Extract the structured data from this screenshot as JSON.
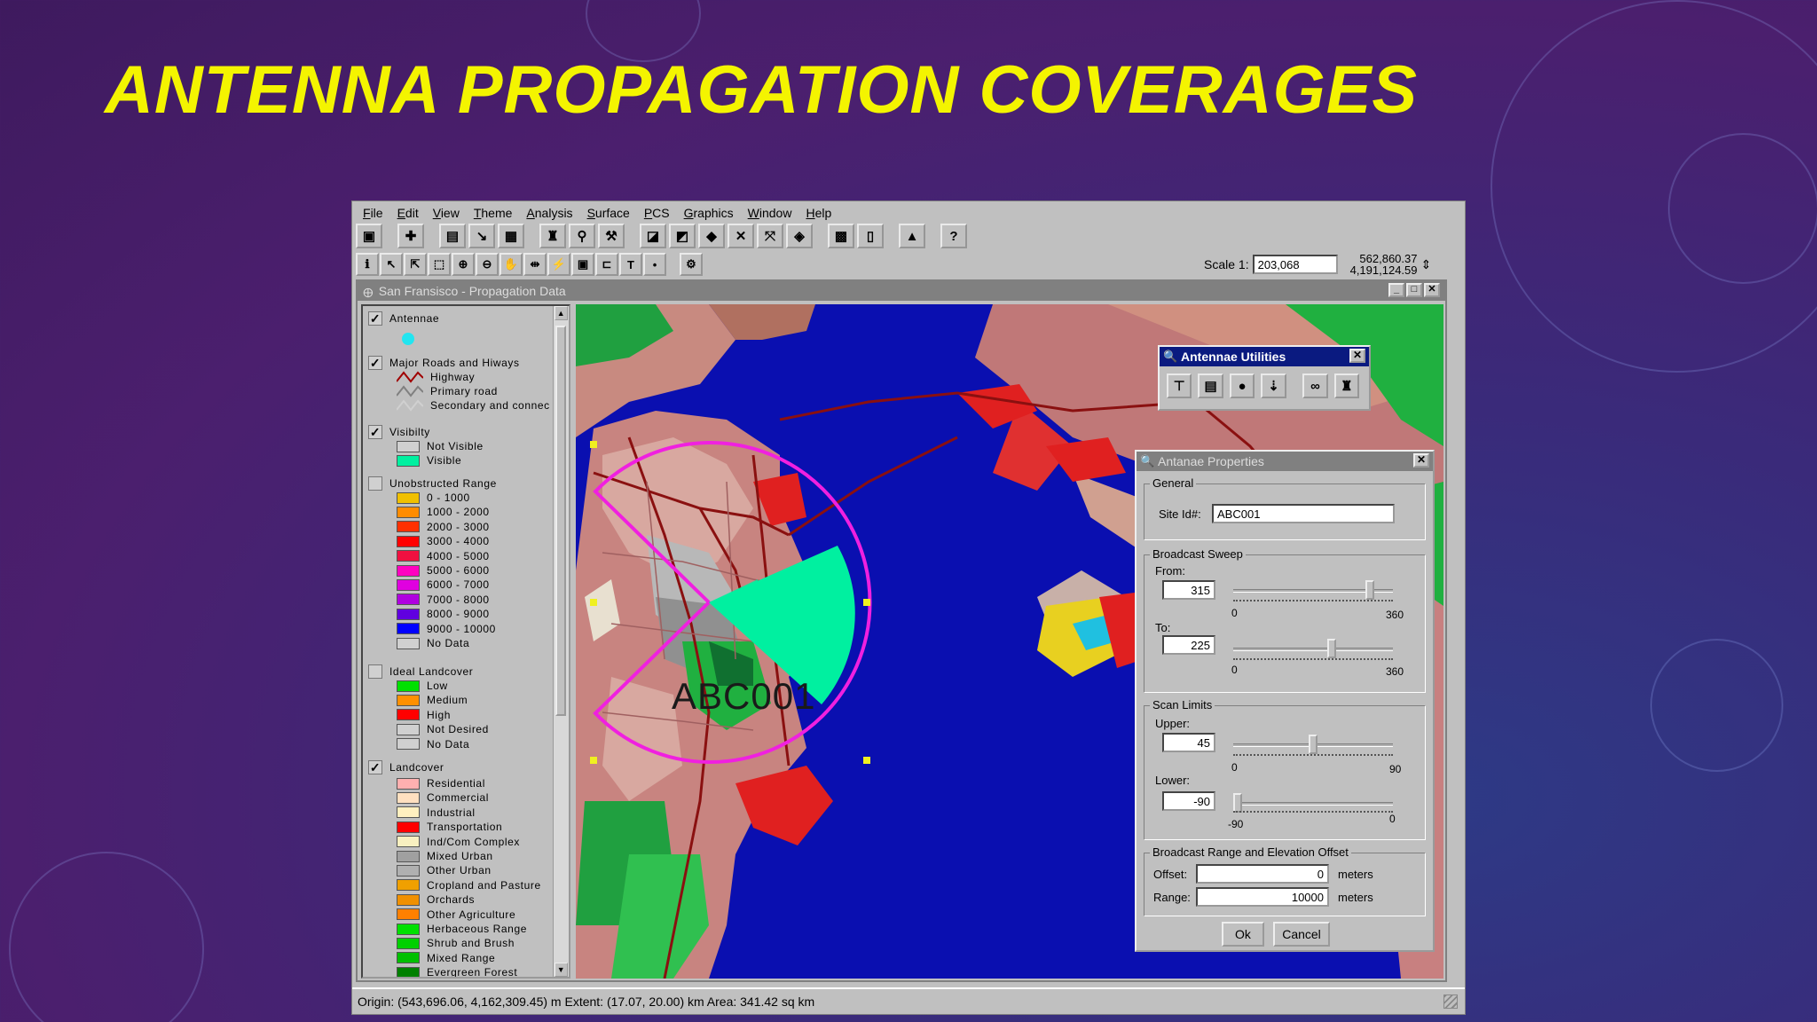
{
  "slide": {
    "title": "ANTENNA PROPAGATION COVERAGES"
  },
  "menu": [
    "File",
    "Edit",
    "View",
    "Theme",
    "Analysis",
    "Surface",
    "PCS",
    "Graphics",
    "Window",
    "Help"
  ],
  "toolbar": {
    "row1_icons": [
      "save-icon",
      "add-theme-icon",
      "properties-icon",
      "edit-legend-icon",
      "table-icon",
      "find-icon",
      "locate-icon",
      "hotlink-icon",
      "zoom-theme-icon",
      "zoom-selected-icon",
      "zoom-active-icon",
      "zoom-full-icon",
      "zoom-previous-icon",
      "select-all-icon",
      "clear-select-icon",
      "layout-icon",
      "help-icon"
    ],
    "row2_icons": [
      "identify-icon",
      "pointer-icon",
      "vertex-edit-icon",
      "select-feature-icon",
      "zoom-in-icon",
      "zoom-out-icon",
      "pan-icon",
      "measure-icon",
      "hotlink-tool-icon",
      "area-select-icon",
      "label-icon",
      "text-icon",
      "draw-point-icon",
      "antenna-tool-icon"
    ],
    "scale_label": "Scale 1:",
    "scale_value": "203,068",
    "coord_x": "562,860.37",
    "coord_y": "4,191,124.59"
  },
  "view": {
    "title": "San Fransisco - Propagation Data"
  },
  "legend": {
    "antennae": "Antennae",
    "roads": {
      "title": "Major Roads and Hiways",
      "items": [
        "Highway",
        "Primary road",
        "Secondary and connec"
      ]
    },
    "visibility": {
      "title": "Visibilty",
      "items": [
        "Not Visible",
        "Visible"
      ]
    },
    "range": {
      "title": "Unobstructed Range",
      "items": [
        "0 - 1000",
        "1000 - 2000",
        "2000 - 3000",
        "3000 - 4000",
        "4000 - 5000",
        "5000 - 6000",
        "6000 - 7000",
        "7000 - 8000",
        "8000 - 9000",
        "9000 - 10000",
        "No Data"
      ]
    },
    "ideal": {
      "title": "Ideal Landcover",
      "items": [
        "Low",
        "Medium",
        "High",
        "Not Desired",
        "No Data"
      ]
    },
    "landcover": {
      "title": "Landcover",
      "items": [
        "Residential",
        "Commercial",
        "Industrial",
        "Transportation",
        "Ind/Com Complex",
        "Mixed Urban",
        "Other Urban",
        "Cropland and Pasture",
        "Orchards",
        "Other Agriculture",
        "Herbaceous Range",
        "Shrub and Brush",
        "Mixed Range",
        "Evergreen Forest"
      ]
    },
    "colors": {
      "range": [
        "#f0c000",
        "#ff8c00",
        "#ff3000",
        "#ff0000",
        "#f01040",
        "#ff00c0",
        "#e000e0",
        "#b000e0",
        "#6000e0",
        "#0000ff",
        "#d0d0d0"
      ],
      "ideal": [
        "#00e000",
        "#ff9000",
        "#ff0000",
        "#d0d0d0",
        "#d0d0d0"
      ],
      "landcover": [
        "#ffb0b0",
        "#ffe0c0",
        "#fff0c0",
        "#ff0000",
        "#f8f0c0",
        "#a0a0a0",
        "#b0b0b0",
        "#f0a000",
        "#f09000",
        "#ff8000",
        "#00e000",
        "#00d000",
        "#00c000",
        "#008000"
      ],
      "visibility": [
        "#d0d0d0",
        "#00f0a0"
      ]
    }
  },
  "map": {
    "site_label": "ABC001"
  },
  "utilities": {
    "title": "Antennae Utilities",
    "icons": [
      "antenna-add-icon",
      "antenna-table-icon",
      "coverage-icon",
      "antenna-move-icon",
      "antenna-view-icon",
      "antenna-find-icon"
    ]
  },
  "properties": {
    "title": "Antanae Properties",
    "general_label": "General",
    "site_id_label": "Site Id#:",
    "site_id": "ABC001",
    "sweep_label": "Broadcast Sweep",
    "from_label": "From:",
    "from_value": "315",
    "from_min": "0",
    "from_max": "360",
    "from_level": 0.875,
    "to_label": "To:",
    "to_value": "225",
    "to_min": "0",
    "to_max": "360",
    "to_level": 0.625,
    "scan_label": "Scan Limits",
    "upper_label": "Upper:",
    "upper_value": "45",
    "upper_min": "0",
    "upper_max": "90",
    "upper_level": 0.5,
    "lower_label": "Lower:",
    "lower_value": "-90",
    "lower_min": "-90",
    "lower_max": "0",
    "lower_level": 0.0,
    "range_group_label": "Broadcast Range and Elevation Offset",
    "offset_label": "Offset:",
    "offset_value": "0",
    "offset_unit": "meters",
    "range_label": "Range:",
    "range_value": "10000",
    "range_unit": "meters",
    "ok": "Ok",
    "cancel": "Cancel"
  },
  "status": {
    "text": "Origin: (543,696.06, 4,162,309.45) m  Extent: (17.07, 20.00) km  Area: 341.42 sq km"
  }
}
